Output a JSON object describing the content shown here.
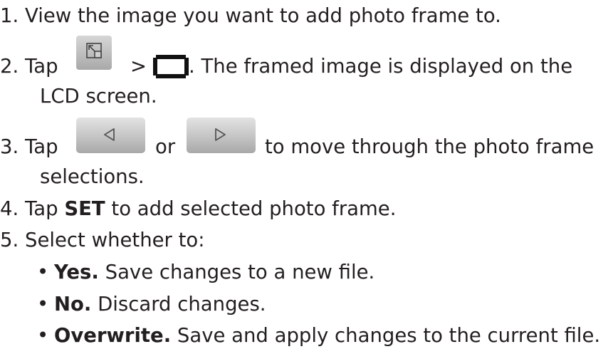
{
  "steps": [
    {
      "number": "1.",
      "text": "View the image you want to add photo frame to."
    },
    {
      "number": "2.",
      "before": "Tap",
      "between": ">",
      "after": ". The framed image is displayed on the",
      "continuation": "LCD screen."
    },
    {
      "number": "3.",
      "before": "Tap",
      "between": "or",
      "after": "to move through the photo frame",
      "continuation": "selections."
    },
    {
      "number": "4.",
      "before": "Tap",
      "bold": "SET",
      "after": "to add selected photo frame."
    },
    {
      "number": "5.",
      "text": "Select whether to:"
    }
  ],
  "options": [
    {
      "label": "Yes.",
      "text": "Save changes to a new file."
    },
    {
      "label": "No.",
      "text": "Discard changes."
    },
    {
      "label": "Overwrite.",
      "text": "Save and apply changes to the current file."
    }
  ],
  "bullet": "•",
  "icons": {
    "edit": "edit-icon",
    "frame": "photo-frame-icon",
    "previous": "previous-arrow-icon",
    "next": "next-arrow-icon"
  },
  "colors": {
    "text": "#231f20",
    "button_light": "#e3e3e3",
    "button_dark": "#a8a8a8",
    "frame_icon": "#111111"
  }
}
